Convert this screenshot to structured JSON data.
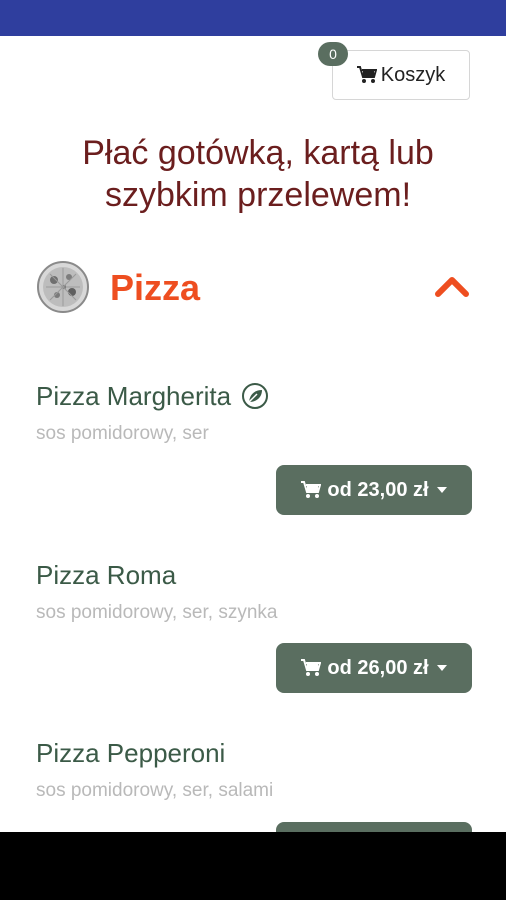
{
  "header": {
    "cart_label": "Koszyk",
    "cart_count": "0"
  },
  "promo": {
    "line1": "Płać gotówką, kartą lub",
    "line2": "szybkim przelewem!"
  },
  "category": {
    "title": "Pizza"
  },
  "products": [
    {
      "name": "Pizza Margherita",
      "description": "sos pomidorowy, ser",
      "price": "od 23,00 zł",
      "vegetarian": true
    },
    {
      "name": "Pizza Roma",
      "description": "sos pomidorowy, ser, szynka",
      "price": "od 26,00 zł",
      "vegetarian": false
    },
    {
      "name": "Pizza Pepperoni",
      "description": "sos pomidorowy, ser, salami",
      "price": "",
      "vegetarian": false
    }
  ],
  "colors": {
    "status_bar": "#2f3e9e",
    "accent": "#ee4e20",
    "button": "#5a6e60",
    "promo_text": "#6b1e1e",
    "product_name": "#3b5a47"
  }
}
